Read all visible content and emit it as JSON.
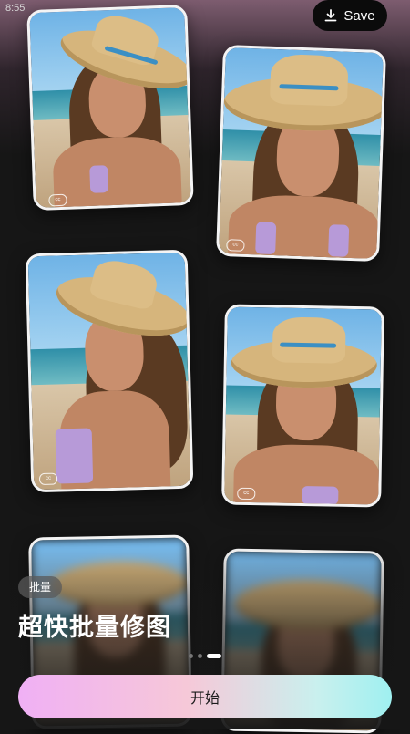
{
  "status_bar": {
    "time": "8:55"
  },
  "header": {
    "save_label": "Save",
    "save_icon": "download-icon"
  },
  "gallery": {
    "cards": [
      {
        "id": "photo-1",
        "badge": "cc"
      },
      {
        "id": "photo-2",
        "badge": "cc"
      },
      {
        "id": "photo-3",
        "badge": "cc"
      },
      {
        "id": "photo-4",
        "badge": "cc"
      },
      {
        "id": "photo-5",
        "badge": ""
      },
      {
        "id": "photo-6",
        "badge": ""
      }
    ]
  },
  "feature": {
    "tag": "批量",
    "headline": "超快批量修图"
  },
  "pager": {
    "count": 3,
    "active_index": 2
  },
  "cta": {
    "start_label": "开始"
  },
  "colors": {
    "accent_gradient_start": "#f0b0f5",
    "accent_gradient_end": "#9ff0f0",
    "background": "#161616"
  }
}
